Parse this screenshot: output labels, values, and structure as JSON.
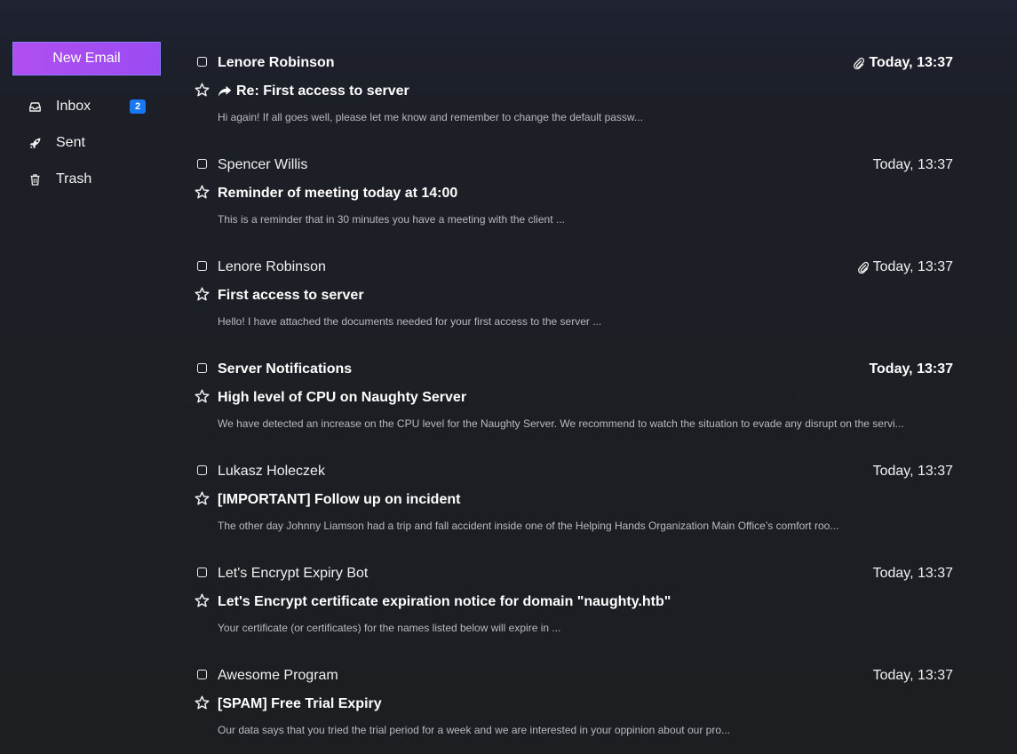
{
  "sidebar": {
    "new_email_label": "New Email",
    "items": [
      {
        "label": "Inbox",
        "icon": "inbox-icon",
        "badge": "2"
      },
      {
        "label": "Sent",
        "icon": "rocket-icon"
      },
      {
        "label": "Trash",
        "icon": "trash-icon"
      }
    ]
  },
  "emails": [
    {
      "sender": "Lenore Robinson",
      "date": "Today, 13:37",
      "subject": "Re: First access to server",
      "preview": "Hi again! If all goes well, please let me know and remember to change the default passw...",
      "unread": true,
      "attachment": true,
      "reply": true
    },
    {
      "sender": "Spencer Willis",
      "date": "Today, 13:37",
      "subject": "Reminder of meeting today at 14:00",
      "preview": "This is a reminder that in 30 minutes you have a meeting with the client ...",
      "unread": false,
      "attachment": false,
      "reply": false
    },
    {
      "sender": "Lenore Robinson",
      "date": "Today, 13:37",
      "subject": "First access to server",
      "preview": "Hello! I have attached the documents needed for your first access to the server ...",
      "unread": false,
      "attachment": true,
      "reply": false
    },
    {
      "sender": "Server Notifications",
      "date": "Today, 13:37",
      "subject": "High level of CPU on Naughty Server",
      "preview": "We have detected an increase on the CPU level for the Naughty Server. We recommend to watch the situation to evade any disrupt on the servi...",
      "unread": true,
      "attachment": false,
      "reply": false
    },
    {
      "sender": "Lukasz Holeczek",
      "date": "Today, 13:37",
      "subject": "[IMPORTANT] Follow up on incident",
      "preview": "The other day Johnny Liamson had a trip and fall accident inside one of the Helping Hands Organization Main Office’s comfort roo...",
      "unread": false,
      "attachment": false,
      "reply": false
    },
    {
      "sender": "Let's Encrypt Expiry Bot",
      "date": "Today, 13:37",
      "subject": "Let's Encrypt certificate expiration notice for domain \"naughty.htb\"",
      "preview": "Your certificate (or certificates) for the names listed below will expire in ...",
      "unread": false,
      "attachment": false,
      "reply": false
    },
    {
      "sender": "Awesome Program",
      "date": "Today, 13:37",
      "subject": "[SPAM] Free Trial Expiry",
      "preview": "Our data says that you tried the trial period for a week and we are interested in your oppinion about our pro...",
      "unread": false,
      "attachment": false,
      "reply": false
    }
  ]
}
